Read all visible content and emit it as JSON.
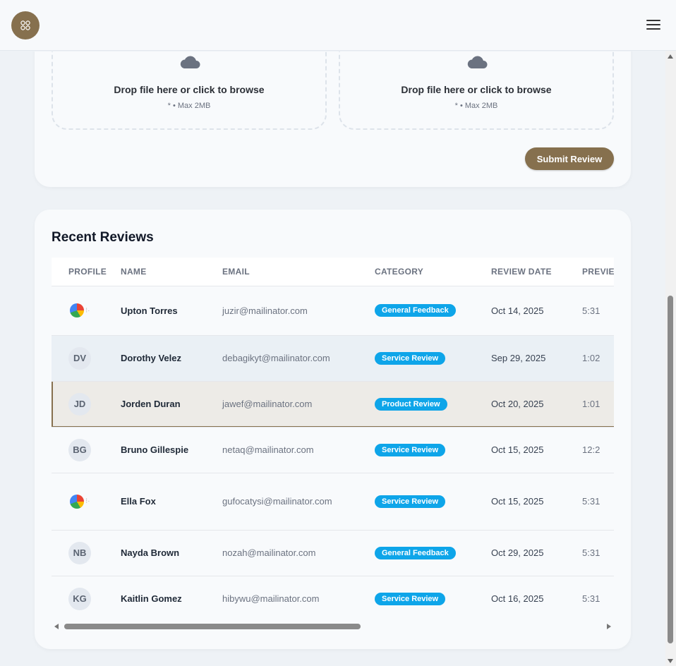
{
  "brand": {
    "accent": "#86704e",
    "badge_color": "#0ea5e9",
    "logo_icon": "grid-icon"
  },
  "header": {
    "menu_icon": "hamburger-icon"
  },
  "upload": {
    "zones": [
      {
        "icon": "cloud-icon",
        "title": "Drop file here or click to browse",
        "hint": "* • Max 2MB"
      },
      {
        "icon": "cloud-icon",
        "title": "Drop file here or click to browse",
        "hint": "* • Max 2MB"
      }
    ],
    "submit_label": "Submit Review"
  },
  "reviews": {
    "title": "Recent Reviews",
    "columns": [
      "PROFILE",
      "NAME",
      "EMAIL",
      "CATEGORY",
      "REVIEW DATE",
      "PREVIEW"
    ],
    "rows": [
      {
        "profile": "image",
        "initials": "",
        "name": "Upton Torres",
        "email": "juzir@mailinator.com",
        "category": "General Feedback",
        "date": "Oct 14, 2025",
        "extra": "5:31"
      },
      {
        "profile": "initials",
        "initials": "DV",
        "name": "Dorothy Velez",
        "email": "debagikyt@mailinator.com",
        "category": "Service Review",
        "date": "Sep 29, 2025",
        "extra": "1:02"
      },
      {
        "profile": "initials",
        "initials": "JD",
        "name": "Jorden Duran",
        "email": "jawef@mailinator.com",
        "category": "Product Review",
        "date": "Oct 20, 2025",
        "extra": "1:01"
      },
      {
        "profile": "initials",
        "initials": "BG",
        "name": "Bruno Gillespie",
        "email": "netaq@mailinator.com",
        "category": "Service Review",
        "date": "Oct 15, 2025",
        "extra": "12:2"
      },
      {
        "profile": "image",
        "initials": "",
        "name": "Ella Fox",
        "email": "gufocatysi@mailinator.com",
        "category": "Service Review",
        "date": "Oct 15, 2025",
        "extra": "5:31"
      },
      {
        "profile": "initials",
        "initials": "NB",
        "name": "Nayda Brown",
        "email": "nozah@mailinator.com",
        "category": "General Feedback",
        "date": "Oct 29, 2025",
        "extra": "5:31"
      },
      {
        "profile": "initials",
        "initials": "KG",
        "name": "Kaitlin Gomez",
        "email": "hibywu@mailinator.com",
        "category": "Service Review",
        "date": "Oct 16, 2025",
        "extra": "5:31"
      }
    ]
  }
}
